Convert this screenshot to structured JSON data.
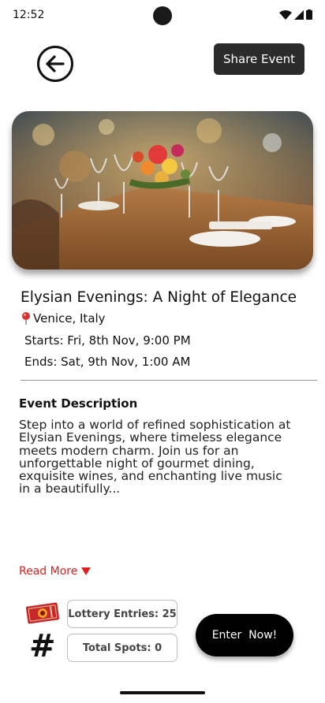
{
  "status_bar": {
    "time": "12:52"
  },
  "top_bar": {
    "back_icon": "arrow-left-circle-icon",
    "share_label": "Share Event"
  },
  "event": {
    "title": "Elysian Evenings: A Night of Elegance",
    "location": "Venice, Italy",
    "starts": "Starts: Fri, 8th Nov, 9:00 PM",
    "ends": "Ends: Sat, 9th Nov, 1:00 AM"
  },
  "description": {
    "heading": "Event Description",
    "body": "Step into a world of refined sophistication at Elysian Evenings, where timeless elegance meets modern charm. Join us for an unforgettable night of gourmet dining, exquisite wines, and enchanting live music in a beautifully...",
    "read_more": "Read More"
  },
  "stats": {
    "lottery_entries": "Lottery Entries: 25",
    "total_spots": "Total Spots: 0",
    "hash_symbol": "#"
  },
  "actions": {
    "enter_label": "Enter  Now!"
  },
  "colors": {
    "accent_red": "#e0201f",
    "share_bg": "#2b2b2b",
    "enter_bg": "#000000"
  }
}
